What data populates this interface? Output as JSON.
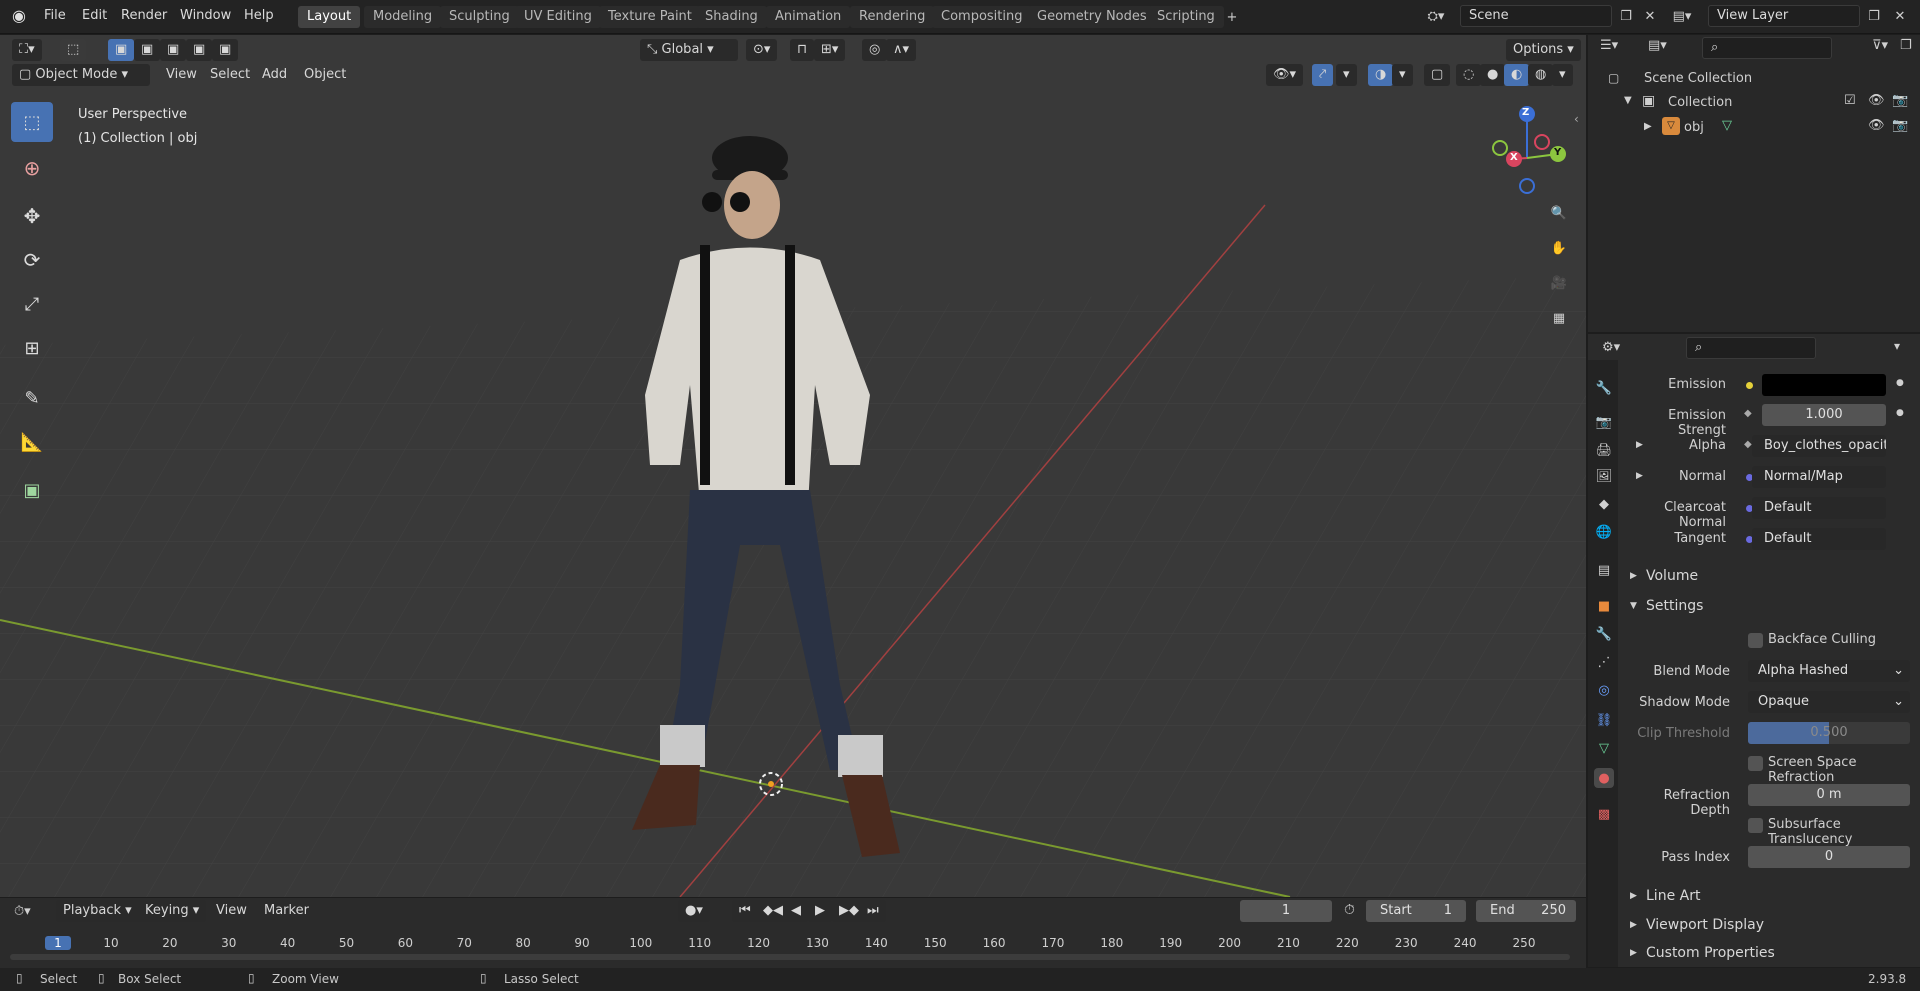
{
  "menu": [
    "File",
    "Edit",
    "Render",
    "Window",
    "Help"
  ],
  "workspaces": [
    "Layout",
    "Modeling",
    "Sculpting",
    "UV Editing",
    "Texture Paint",
    "Shading",
    "Animation",
    "Rendering",
    "Compositing",
    "Geometry Nodes",
    "Scripting"
  ],
  "active_workspace": "Layout",
  "scene": "Scene",
  "view_layer": "View Layer",
  "viewport": {
    "mode": "Object Mode",
    "menus": [
      "View",
      "Select",
      "Add",
      "Object"
    ],
    "orientation": "Global",
    "options_label": "Options",
    "perspective": "User Perspective",
    "collection_info": "(1) Collection | obj",
    "gizmo_axes": {
      "x": "X",
      "y": "Y",
      "z": "Z"
    }
  },
  "outliner": {
    "scene_collection": "Scene Collection",
    "collection": "Collection",
    "object": "obj"
  },
  "properties": {
    "emission_label": "Emission",
    "emission_strength_label": "Emission Strengt",
    "emission_strength": "1.000",
    "alpha_label": "Alpha",
    "alpha_value": "Boy_clothes_opacity...",
    "normal_label": "Normal",
    "normal_value": "Normal/Map",
    "clearcoat_label": "Clearcoat Normal",
    "clearcoat_value": "Default",
    "tangent_label": "Tangent",
    "tangent_value": "Default",
    "volume_section": "Volume",
    "settings_section": "Settings",
    "backface_culling": "Backface Culling",
    "blend_mode_label": "Blend Mode",
    "blend_mode": "Alpha Hashed",
    "shadow_mode_label": "Shadow Mode",
    "shadow_mode": "Opaque",
    "clip_threshold_label": "Clip Threshold",
    "clip_threshold": "0.500",
    "screen_space_refraction": "Screen Space Refraction",
    "refraction_depth_label": "Refraction Depth",
    "refraction_depth": "0 m",
    "subsurface_translucency": "Subsurface Translucency",
    "pass_index_label": "Pass Index",
    "pass_index": "0",
    "line_art": "Line Art",
    "viewport_display": "Viewport Display",
    "custom_properties": "Custom Properties"
  },
  "timeline": {
    "menus": [
      "Playback",
      "Keying",
      "View",
      "Marker"
    ],
    "current_frame": "1",
    "start_label": "Start",
    "start": "1",
    "end_label": "End",
    "end": "250",
    "ruler": [
      "1",
      "10",
      "20",
      "30",
      "40",
      "50",
      "60",
      "70",
      "80",
      "90",
      "100",
      "110",
      "120",
      "130",
      "140",
      "150",
      "160",
      "170",
      "180",
      "190",
      "200",
      "210",
      "220",
      "230",
      "240",
      "250"
    ]
  },
  "statusbar": {
    "select": "Select",
    "box_select": "Box Select",
    "zoom_view": "Zoom View",
    "lasso_select": "Lasso Select",
    "version": "2.93.8"
  }
}
